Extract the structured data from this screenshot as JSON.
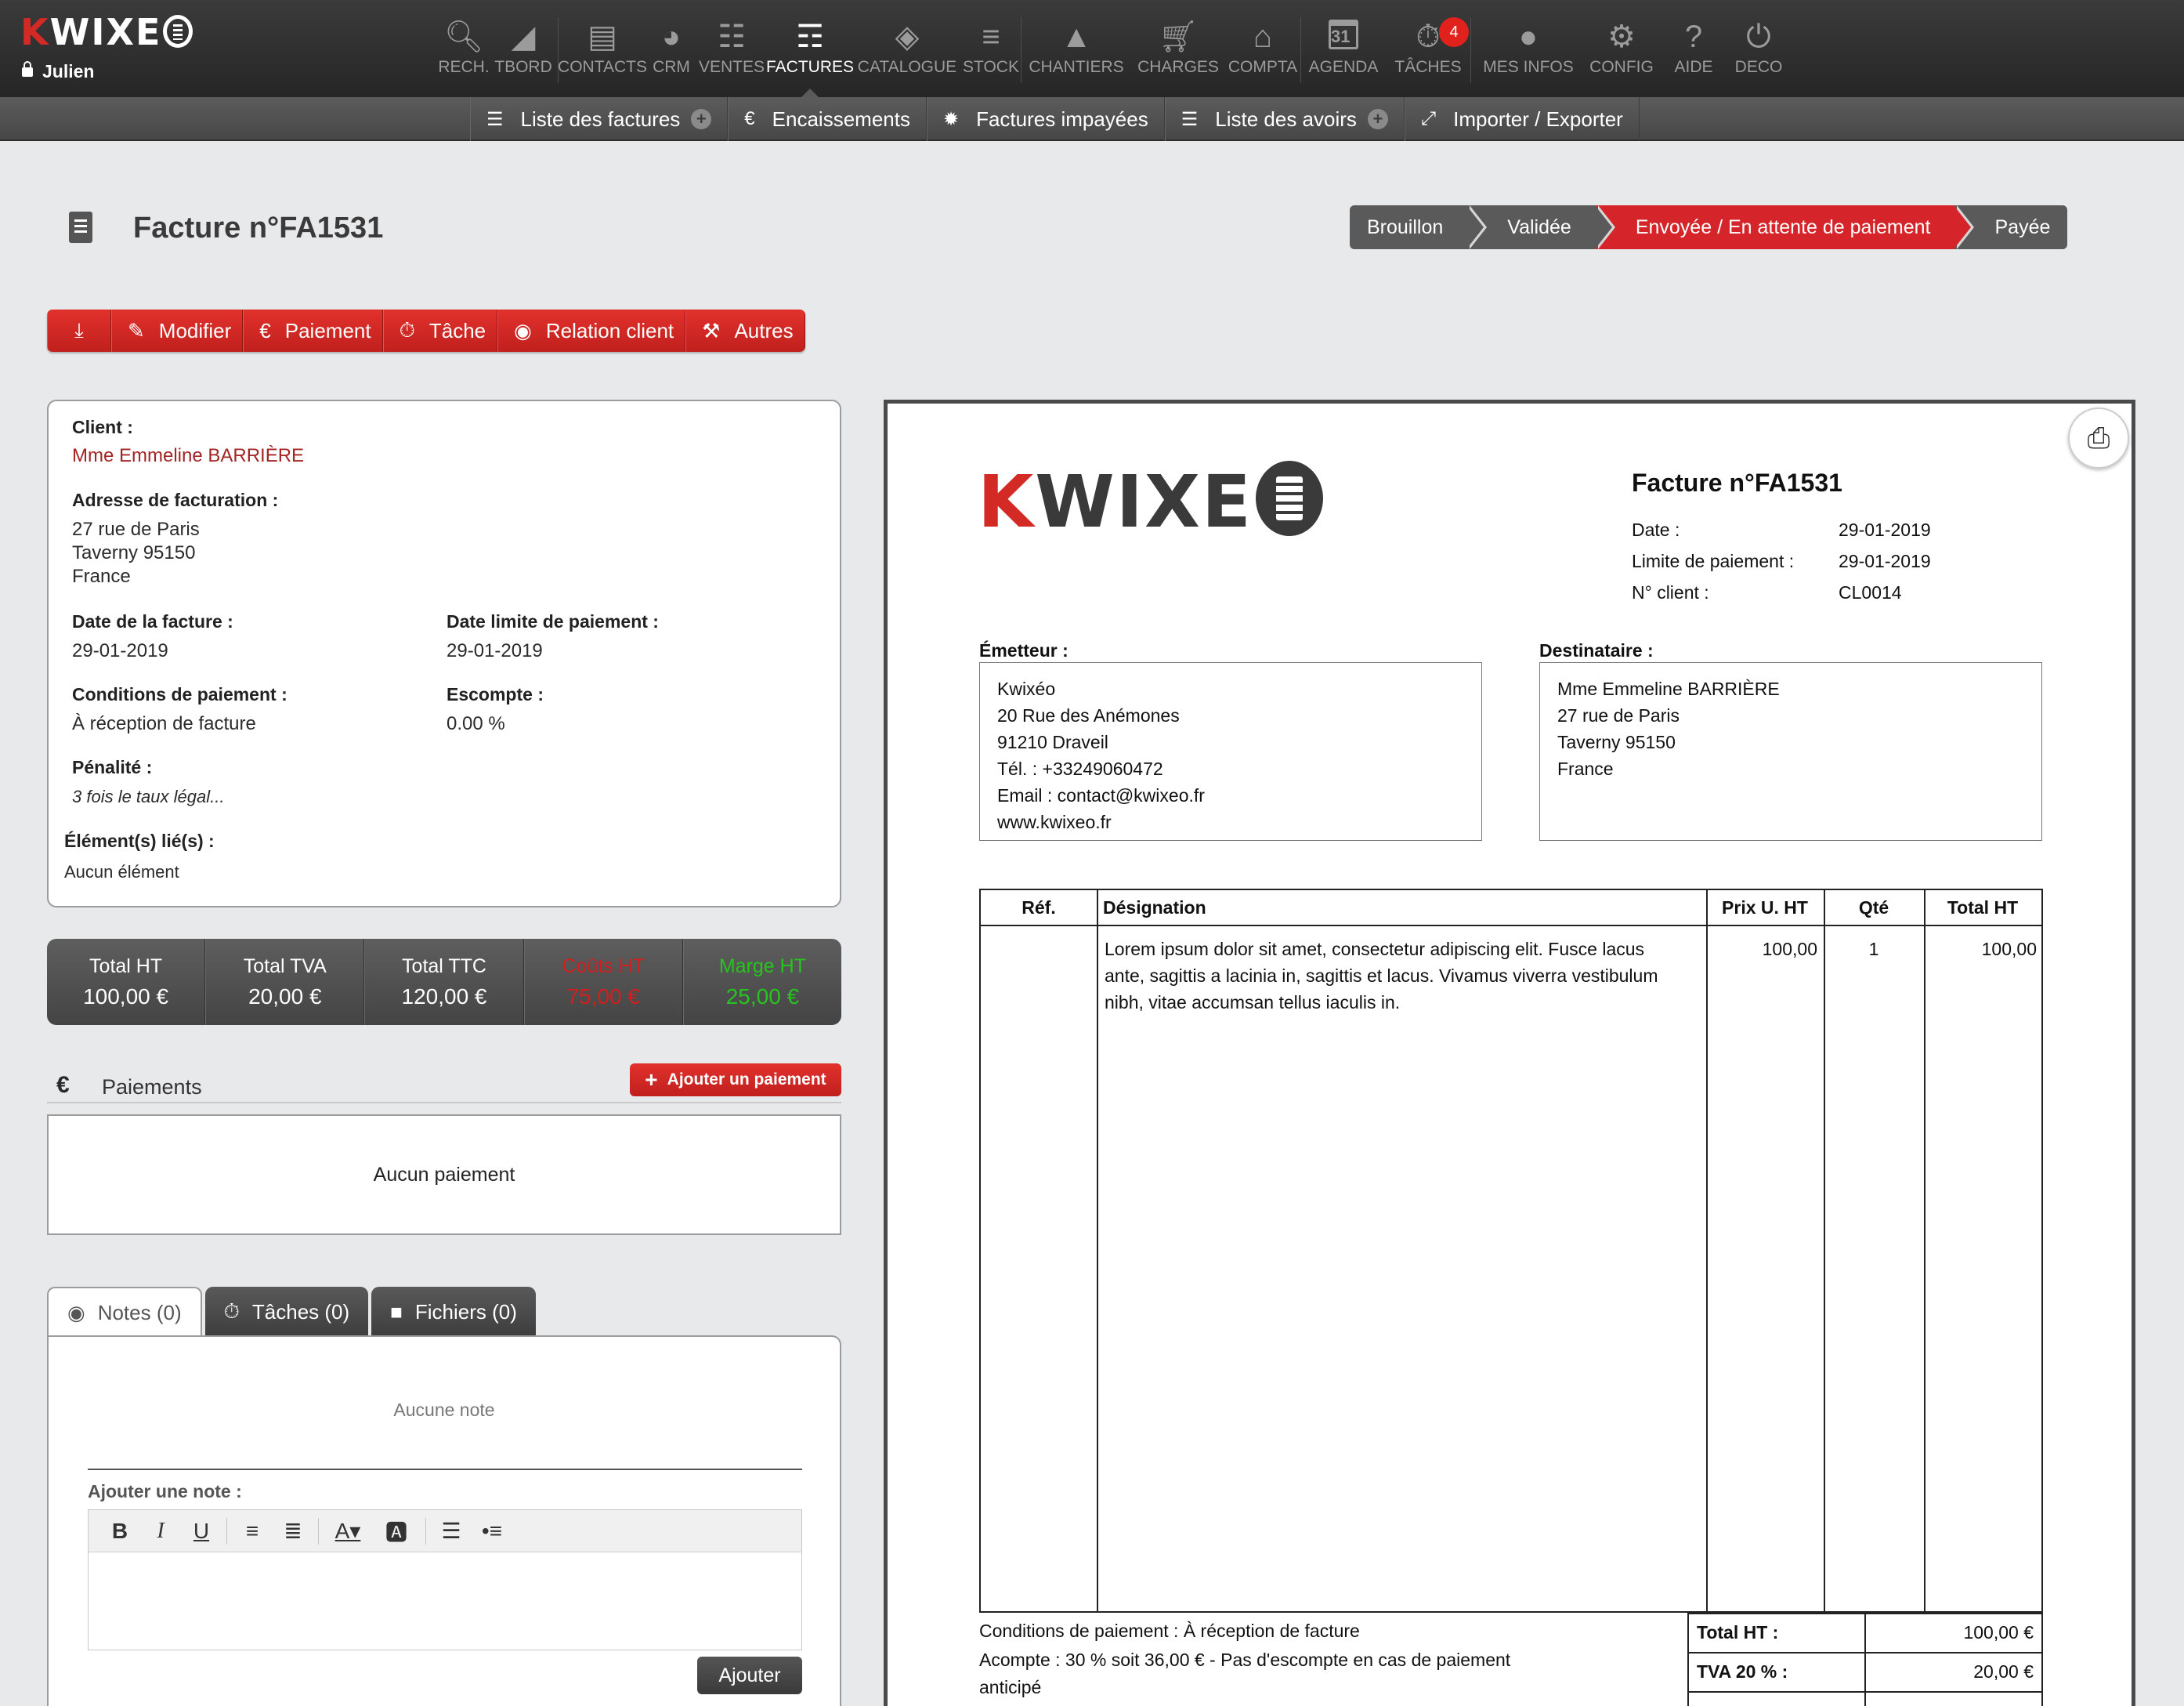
{
  "app": {
    "logo_k": "K",
    "logo_rest": "WIXE",
    "user": "Julien"
  },
  "nav": [
    {
      "label": "RECH.",
      "icon": "search-icon"
    },
    {
      "label": "TBORD",
      "icon": "chart-icon"
    },
    {
      "label": "CONTACTS",
      "icon": "address-book-icon"
    },
    {
      "label": "CRM",
      "icon": "dashboard-icon"
    },
    {
      "label": "VENTES",
      "icon": "document-icon"
    },
    {
      "label": "FACTURES",
      "icon": "invoice-icon",
      "active": true
    },
    {
      "label": "CATALOGUE",
      "icon": "catalog-icon"
    },
    {
      "label": "STOCK",
      "icon": "stock-icon"
    },
    {
      "label": "CHANTIERS",
      "icon": "cone-icon"
    },
    {
      "label": "CHARGES",
      "icon": "cart-icon"
    },
    {
      "label": "COMPTA",
      "icon": "bank-icon"
    },
    {
      "label": "AGENDA",
      "icon": "calendar-icon",
      "calendar_day": "31"
    },
    {
      "label": "TÂCHES",
      "icon": "stopwatch-icon",
      "badge": "4"
    },
    {
      "label": "MES INFOS",
      "icon": "user-icon"
    },
    {
      "label": "CONFIG",
      "icon": "gear-icon"
    },
    {
      "label": "AIDE",
      "icon": "help-icon"
    },
    {
      "label": "DECO",
      "icon": "power-icon"
    }
  ],
  "subnav": {
    "list_invoices": "Liste des factures",
    "receipts": "Encaissements",
    "unpaid": "Factures impayées",
    "credit_notes": "Liste des avoirs",
    "import_export": "Importer / Exporter"
  },
  "page": {
    "title": "Facture n°FA1531"
  },
  "status_steps": [
    "Brouillon",
    "Validée",
    "Envoyée / En attente de paiement",
    "Payée"
  ],
  "actions": {
    "edit": "Modifier",
    "payment": "Paiement",
    "task": "Tâche",
    "client_relation": "Relation client",
    "other": "Autres"
  },
  "info": {
    "client_label": "Client :",
    "client": "Mme Emmeline BARRIÈRE",
    "billing_label": "Adresse de facturation :",
    "billing_line1": "27 rue de Paris",
    "billing_line2": "Taverny 95150",
    "billing_line3": "France",
    "date_label": "Date de la facture :",
    "date": "29-01-2019",
    "due_label": "Date limite de paiement :",
    "due": "29-01-2019",
    "terms_label": "Conditions de paiement :",
    "terms": "À réception de facture",
    "discount_label": "Escompte :",
    "discount": "0.00 %",
    "penalty_label": "Pénalité :",
    "penalty": "3 fois le taux légal...",
    "linked_label": "Élément(s) lié(s) :",
    "linked": "Aucun élément"
  },
  "totals": [
    {
      "label": "Total HT",
      "value": "100,00 €"
    },
    {
      "label": "Total TVA",
      "value": "20,00 €"
    },
    {
      "label": "Total TTC",
      "value": "120,00 €"
    },
    {
      "label": "Coûts HT",
      "value": "75,00 €"
    },
    {
      "label": "Marge HT",
      "value": "25,00 €"
    }
  ],
  "payments": {
    "title": "Paiements",
    "add": "Ajouter un paiement",
    "empty": "Aucun paiement"
  },
  "tabs": {
    "notes": "Notes (0)",
    "tasks": "Tâches (0)",
    "files": "Fichiers (0)"
  },
  "notes": {
    "empty": "Aucune note",
    "add_label": "Ajouter une note :",
    "add_button": "Ajouter"
  },
  "invoice": {
    "title": "Facture n°FA1531",
    "date_label": "Date :",
    "date": "29-01-2019",
    "due_label": "Limite de paiement :",
    "due": "29-01-2019",
    "client_no_label": "N° client :",
    "client_no": "CL0014",
    "issuer_label": "Émetteur :",
    "issuer": [
      "Kwixéo",
      "20 Rue des Anémones",
      "91210 Draveil",
      "Tél. : +33249060472",
      "Email : contact@kwixeo.fr",
      "www.kwixeo.fr"
    ],
    "recipient_label": "Destinataire :",
    "recipient": [
      "Mme Emmeline BARRIÈRE",
      "27 rue de Paris",
      "Taverny 95150",
      "France"
    ],
    "columns": {
      "ref": "Réf.",
      "designation": "Désignation",
      "unit_price": "Prix U. HT",
      "qty": "Qté",
      "total": "Total HT"
    },
    "line": {
      "ref": "",
      "designation_1": "Lorem ipsum dolor sit amet, consectetur adipiscing elit. Fusce lacus",
      "designation_2": "ante, sagittis a lacinia in, sagittis et lacus. Vivamus viverra vestibulum",
      "designation_3": "nibh, vitae accumsan tellus iaculis in.",
      "unit_price": "100,00",
      "qty": "1",
      "total": "100,00"
    },
    "conditions": "Conditions de paiement : À réception de facture",
    "deposit_1": "Acompte : 30 % soit 36,00 € - Pas d'escompte en cas de paiement",
    "deposit_2": "anticipé",
    "sum_ht_label": "Total HT :",
    "sum_ht": "100,00 €",
    "sum_vat_label": "TVA 20 % :",
    "sum_vat": "20,00 €"
  },
  "colors": {
    "accent_red": "#d5242a",
    "nav_dark": "#2e2e2e",
    "cost_red": "#d21e1e",
    "margin_green": "#27c41f"
  }
}
